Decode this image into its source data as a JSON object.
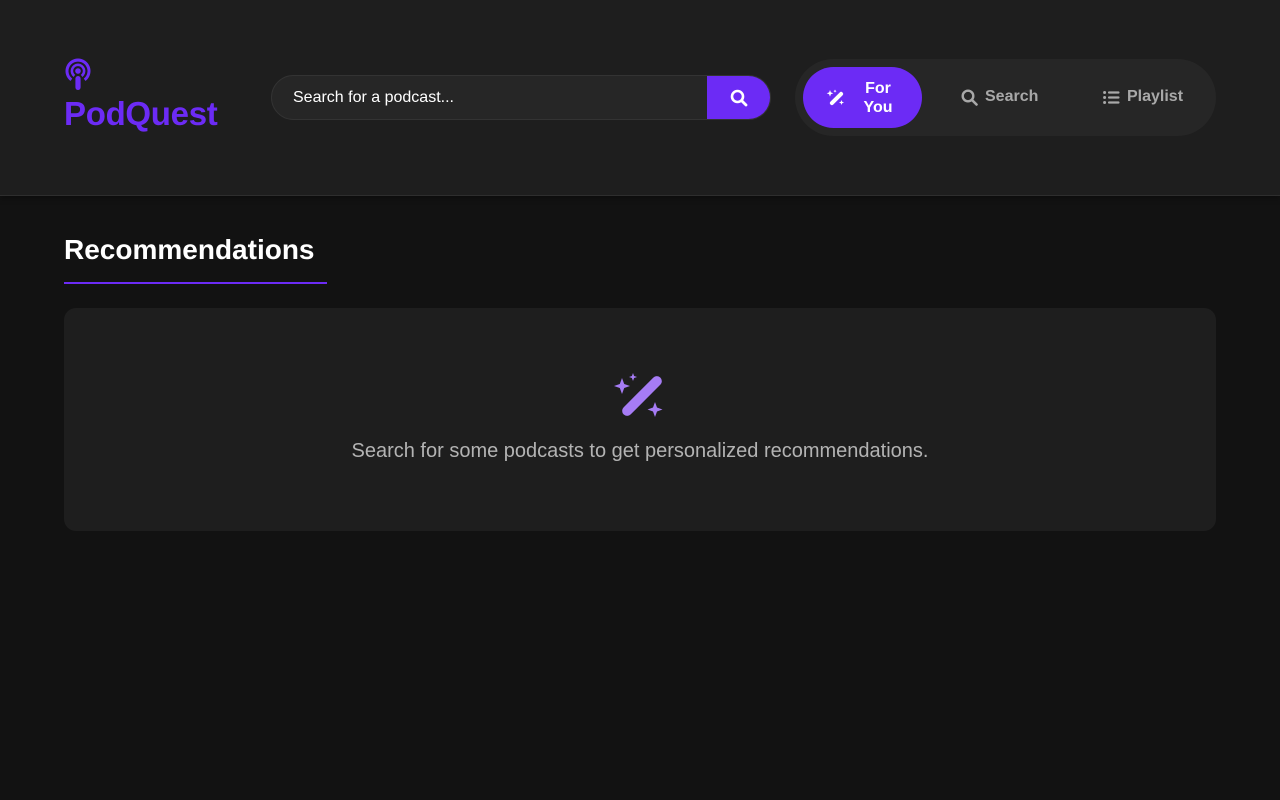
{
  "app": {
    "name": "PodQuest"
  },
  "header": {
    "search": {
      "placeholder": "Search for a podcast..."
    },
    "nav": {
      "tabs": [
        {
          "label": "For You",
          "icon": "magic-wand-icon",
          "active": true
        },
        {
          "label": "Search",
          "icon": "search-icon",
          "active": false
        },
        {
          "label": "Playlist",
          "icon": "list-icon",
          "active": false
        }
      ]
    }
  },
  "main": {
    "section_title": "Recommendations",
    "empty_state": {
      "icon": "magic-wand-sparkles-icon",
      "message": "Search for some podcasts to get personalized recommendations."
    }
  },
  "colors": {
    "accent": "#6c2bf5",
    "accent_light": "#a67cf5",
    "background": "#121212",
    "surface": "#1e1e1e"
  }
}
